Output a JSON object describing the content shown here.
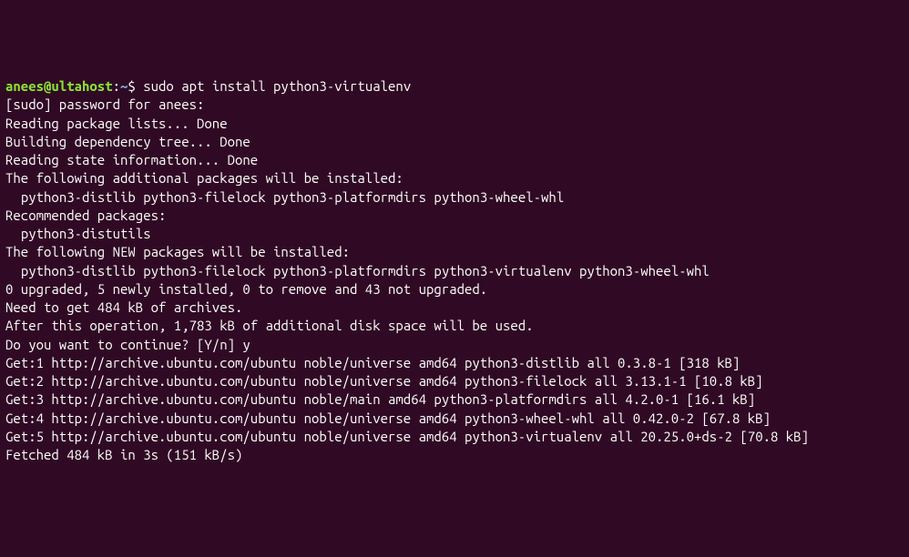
{
  "prompt": {
    "user": "anees@ultahost",
    "colon": ":",
    "path": "~",
    "dollar": "$ ",
    "command": "sudo apt install python3-virtualenv"
  },
  "lines": {
    "l1": "[sudo] password for anees:",
    "l2": "Reading package lists... Done",
    "l3": "Building dependency tree... Done",
    "l4": "Reading state information... Done",
    "l5": "The following additional packages will be installed:",
    "l6": "  python3-distlib python3-filelock python3-platformdirs python3-wheel-whl",
    "l7": "Recommended packages:",
    "l8": "  python3-distutils",
    "l9": "The following NEW packages will be installed:",
    "l10": "  python3-distlib python3-filelock python3-platformdirs python3-virtualenv python3-wheel-whl",
    "l11": "0 upgraded, 5 newly installed, 0 to remove and 43 not upgraded.",
    "l12": "Need to get 484 kB of archives.",
    "l13": "After this operation, 1,783 kB of additional disk space will be used.",
    "l14": "Do you want to continue? [Y/n] y",
    "l15": "Get:1 http://archive.ubuntu.com/ubuntu noble/universe amd64 python3-distlib all 0.3.8-1 [318 kB]",
    "l16": "Get:2 http://archive.ubuntu.com/ubuntu noble/universe amd64 python3-filelock all 3.13.1-1 [10.8 kB]",
    "l17": "Get:3 http://archive.ubuntu.com/ubuntu noble/main amd64 python3-platformdirs all 4.2.0-1 [16.1 kB]",
    "l18": "Get:4 http://archive.ubuntu.com/ubuntu noble/universe amd64 python3-wheel-whl all 0.42.0-2 [67.8 kB]",
    "l19": "Get:5 http://archive.ubuntu.com/ubuntu noble/universe amd64 python3-virtualenv all 20.25.0+ds-2 [70.8 kB]",
    "l20": "Fetched 484 kB in 3s (151 kB/s)"
  }
}
